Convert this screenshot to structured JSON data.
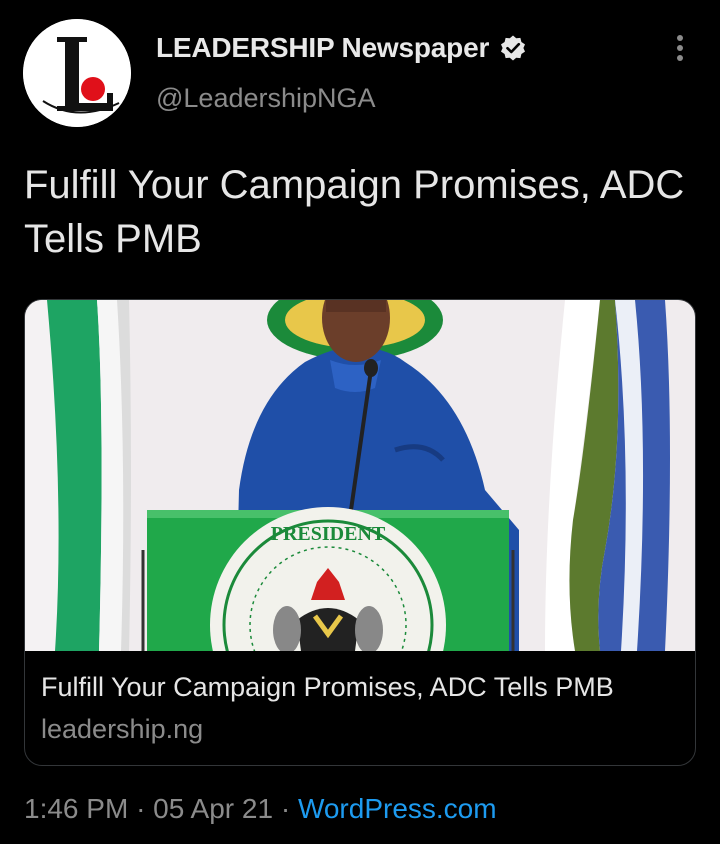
{
  "tweet": {
    "author": {
      "display_name": "LEADERSHIP Newspaper",
      "handle": "@LeadershipNGA",
      "verified": true,
      "avatar_icon": "leadership-logo-icon"
    },
    "text": "Fulfill Your Campaign Promises, ADC Tells PMB",
    "card": {
      "image_description_icon": "news-photo",
      "title": "Fulfill Your Campaign Promises, ADC Tells PMB",
      "domain": "leadership.ng"
    },
    "time": "1:46 PM",
    "separator": "·",
    "date": "05 Apr 21",
    "source": "WordPress.com"
  },
  "colors": {
    "background": "#000000",
    "text_primary": "#e6e6e6",
    "text_secondary": "#8b8b8b",
    "link": "#1d9bf0",
    "card_border": "#333639"
  }
}
